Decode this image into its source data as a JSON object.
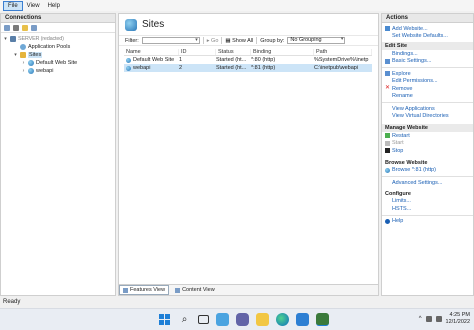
{
  "menu": {
    "items": [
      "File",
      "View",
      "Help"
    ]
  },
  "connections": {
    "header": "Connections",
    "tree": [
      {
        "label": "SERVER (redacted)",
        "arrow": "▾",
        "level": 0
      },
      {
        "label": "Application Pools",
        "arrow": "",
        "level": 1
      },
      {
        "label": "Sites",
        "arrow": "▾",
        "level": 1
      },
      {
        "label": "Default Web Site",
        "arrow": "›",
        "level": 2
      },
      {
        "label": "webapi",
        "arrow": "›",
        "level": 2
      }
    ]
  },
  "main": {
    "title": "Sites",
    "filter": {
      "label": "Filter:",
      "go": "Go",
      "show_all": "Show All",
      "group_by_label": "Group by:",
      "group_by_value": "No Grouping"
    },
    "columns": [
      "Name",
      "ID",
      "Status",
      "Binding",
      "Path"
    ],
    "rows": [
      {
        "name": "Default Web Site",
        "id": "1",
        "status": "Started (ht...",
        "binding": "*:80 (http)",
        "path": "%SystemDrive%\\inetp"
      },
      {
        "name": "webapi",
        "id": "2",
        "status": "Started (ht...",
        "binding": "*:81 (http)",
        "path": "C:\\inetpub\\webapi"
      }
    ],
    "tabs": {
      "features": "Features View",
      "content": "Content View"
    }
  },
  "actions": {
    "header": "Actions",
    "top": [
      "Add Website...",
      "Set Website Defaults..."
    ],
    "edit_site": {
      "title": "Edit Site",
      "items": [
        "Bindings...",
        "Basic Settings...",
        "Explore",
        "Edit Permissions...",
        "Remove",
        "Rename",
        "View Applications",
        "View Virtual Directories"
      ]
    },
    "manage": {
      "title": "Manage Website",
      "items": [
        "Restart",
        "Start",
        "Stop"
      ],
      "browse_title": "Browse Website",
      "browse_items": [
        "Browse *:81 (http)"
      ],
      "advanced": "Advanced Settings..."
    },
    "configure": {
      "title": "Configure",
      "items": [
        "Limits...",
        "HSTS..."
      ]
    },
    "help": "Help"
  },
  "status": {
    "text": "Ready"
  },
  "taskbar": {
    "icons": [
      "start-icon",
      "search-icon",
      "task-view-icon",
      "widgets-icon",
      "chat-icon",
      "file-explorer-icon",
      "edge-icon",
      "store-icon",
      "iis-manager-icon"
    ],
    "time": "4:25 PM",
    "date": "12/1/2022",
    "tray_chevron": "^"
  }
}
